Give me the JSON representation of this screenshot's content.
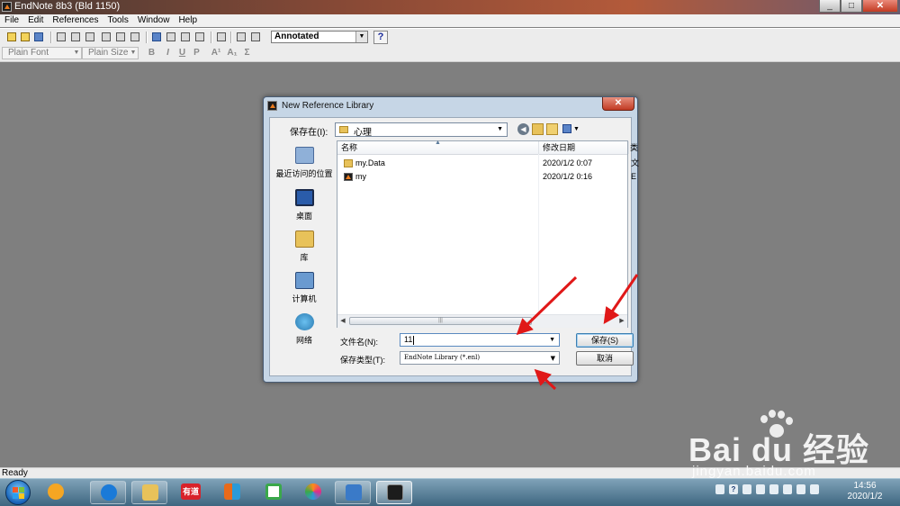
{
  "window": {
    "title": "EndNote 8b3 (Bld 1150)",
    "min": "_",
    "max": "□",
    "close": "✕"
  },
  "menu": [
    "File",
    "Edit",
    "References",
    "Tools",
    "Window",
    "Help"
  ],
  "toolbar": {
    "style_value": "Annotated",
    "help": "?"
  },
  "format_bar": {
    "font": "Plain Font",
    "size": "Plain Size",
    "bold": "B",
    "italic": "I",
    "underline": "U",
    "plain": "P",
    "superscript": "A¹",
    "subscript": "A₁",
    "symbol": "Σ"
  },
  "status": "Ready",
  "dialog": {
    "title": "New Reference Library",
    "close": "✕",
    "save_in_label": "保存在(I):",
    "save_in_value": "心理",
    "places": [
      {
        "label": "最近访问的位置",
        "icon": "recent-places-icon",
        "color": "#6a8fc0"
      },
      {
        "label": "桌面",
        "icon": "desktop-icon",
        "color": "#2a5caa"
      },
      {
        "label": "库",
        "icon": "libraries-icon",
        "color": "#e8c25a"
      },
      {
        "label": "计算机",
        "icon": "computer-icon",
        "color": "#4a7ab0"
      },
      {
        "label": "网络",
        "icon": "network-icon",
        "color": "#3a9a4a"
      }
    ],
    "columns": {
      "name": "名称",
      "date": "修改日期",
      "extra": "类"
    },
    "files": [
      {
        "name": "my.Data",
        "date": "2020/1/2 0:07",
        "extra": "文",
        "type": "folder"
      },
      {
        "name": "my",
        "date": "2020/1/2 0:16",
        "extra": "E",
        "type": "enl"
      }
    ],
    "scroll_grip": "|||",
    "filename_label": "文件名(N):",
    "filename_value": "11",
    "filetype_label": "保存类型(T):",
    "filetype_value": "EndNote Library (*.enl)",
    "save_button": "保存(S)",
    "cancel_button": "取消"
  },
  "taskbar": {
    "apps": [
      {
        "name": "app-360-icon",
        "color": "#f5a623"
      },
      {
        "name": "app-sogou-browser-icon",
        "color": "#1a7ad8"
      },
      {
        "name": "app-file-explorer-icon",
        "color": "#e8c25a"
      },
      {
        "name": "app-youdao-icon",
        "color": "#d8222a",
        "label": "有道"
      },
      {
        "name": "app-office-icon",
        "color": "#e86a1a"
      },
      {
        "name": "app-wps-icon",
        "color": "#3aa84a"
      },
      {
        "name": "app-360-browser-icon",
        "color": "#ff8a1a"
      },
      {
        "name": "app-picture-viewer-icon",
        "color": "#3a7ac8"
      },
      {
        "name": "app-endnote-icon",
        "color": "#1c1c1c"
      }
    ],
    "tray_help": "?",
    "time": "14:56",
    "date": "2020/1/2"
  },
  "watermark": {
    "logo": "Bai du 经验",
    "url": "jingyan.baidu.com"
  }
}
